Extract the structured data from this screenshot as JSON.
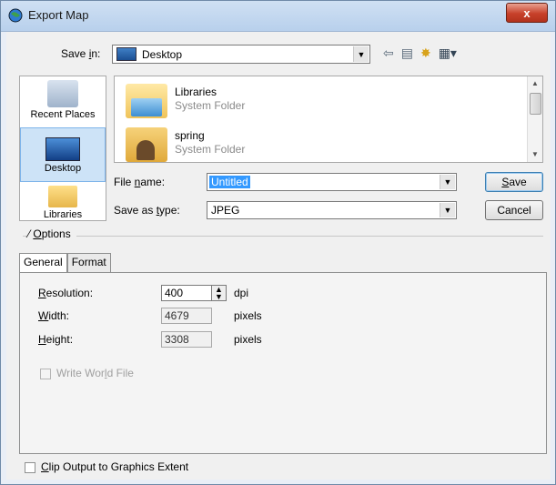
{
  "window": {
    "title": "Export Map",
    "close_glyph": "x"
  },
  "save_in": {
    "label": "Save in:",
    "value": "Desktop",
    "icons": [
      "back-arrow-icon",
      "up-folder-icon",
      "new-folder-icon",
      "view-menu-icon"
    ]
  },
  "places": [
    {
      "label": "Recent Places",
      "icon": "recent-places-icon"
    },
    {
      "label": "Desktop",
      "icon": "desktop-icon"
    },
    {
      "label": "Libraries",
      "icon": "libraries-icon"
    }
  ],
  "files": [
    {
      "name": "Libraries",
      "type": "System Folder",
      "icon": "libraries-folder-icon"
    },
    {
      "name": "spring",
      "type": "System Folder",
      "icon": "user-folder-icon"
    }
  ],
  "file_name": {
    "label": "File name:",
    "value": "Untitled"
  },
  "save_as_type": {
    "label": "Save as type:",
    "value": "JPEG"
  },
  "buttons": {
    "save": "Save",
    "cancel": "Cancel"
  },
  "options": {
    "label": "Options"
  },
  "tabs": [
    {
      "label": "General",
      "active": true
    },
    {
      "label": "Format",
      "active": false
    }
  ],
  "general": {
    "resolution": {
      "label": "Resolution:",
      "value": "400",
      "unit": "dpi"
    },
    "width": {
      "label": "Width:",
      "value": "4679",
      "unit": "pixels"
    },
    "height": {
      "label": "Height:",
      "value": "3308",
      "unit": "pixels"
    },
    "write_world_file": {
      "label": "Write World File",
      "checked": false,
      "enabled": false
    }
  },
  "clip_output": {
    "label": "Clip Output to Graphics Extent",
    "checked": false
  },
  "colors": {
    "accent": "#3399ff",
    "title_bar": "#c4d9f0",
    "close": "#c7412a"
  }
}
